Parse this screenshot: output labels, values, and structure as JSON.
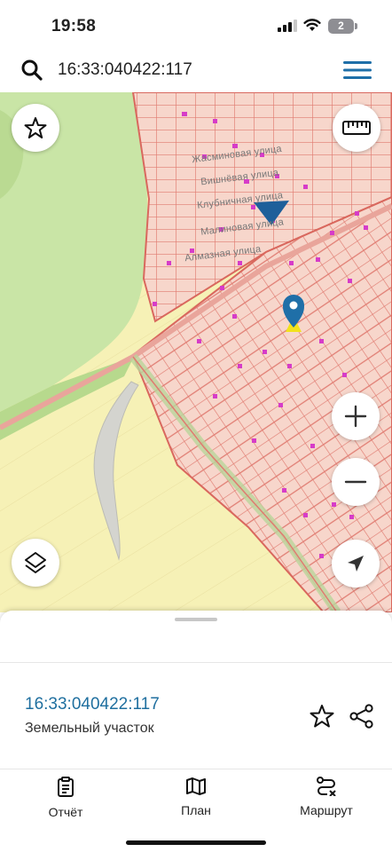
{
  "status_bar": {
    "time": "19:58",
    "battery_level": "2",
    "icons": [
      "signal-icon",
      "wifi-icon",
      "battery-icon"
    ]
  },
  "search": {
    "query": "16:33:040422:117",
    "icons": [
      "search-icon",
      "menu-icon"
    ]
  },
  "map": {
    "street_labels": [
      "Жасминовая улица",
      "Вишнёвая улица",
      "Клубничная улица",
      "Малиновая улица",
      "Алмазная улица"
    ],
    "controls": [
      "favorite-star-icon",
      "ruler-icon",
      "zoom-in-icon",
      "zoom-out-icon",
      "layers-icon",
      "locate-arrow-icon"
    ],
    "colors": {
      "fields": "#f6f1b6",
      "forest": "#c9e5a6",
      "parcels": "#e8837a",
      "parcel_fill": "#f6d3c8",
      "buildings": "#d63cc8",
      "road": "#cfcfcf",
      "pin": "#1f6fa8"
    }
  },
  "sheet": {
    "parcel_number": "16:33:040422:117",
    "parcel_type": "Земельный участок"
  },
  "tabs": [
    {
      "label": "Отчёт",
      "icon": "report-icon"
    },
    {
      "label": "План",
      "icon": "map-plan-icon"
    },
    {
      "label": "Маршрут",
      "icon": "route-icon"
    }
  ]
}
